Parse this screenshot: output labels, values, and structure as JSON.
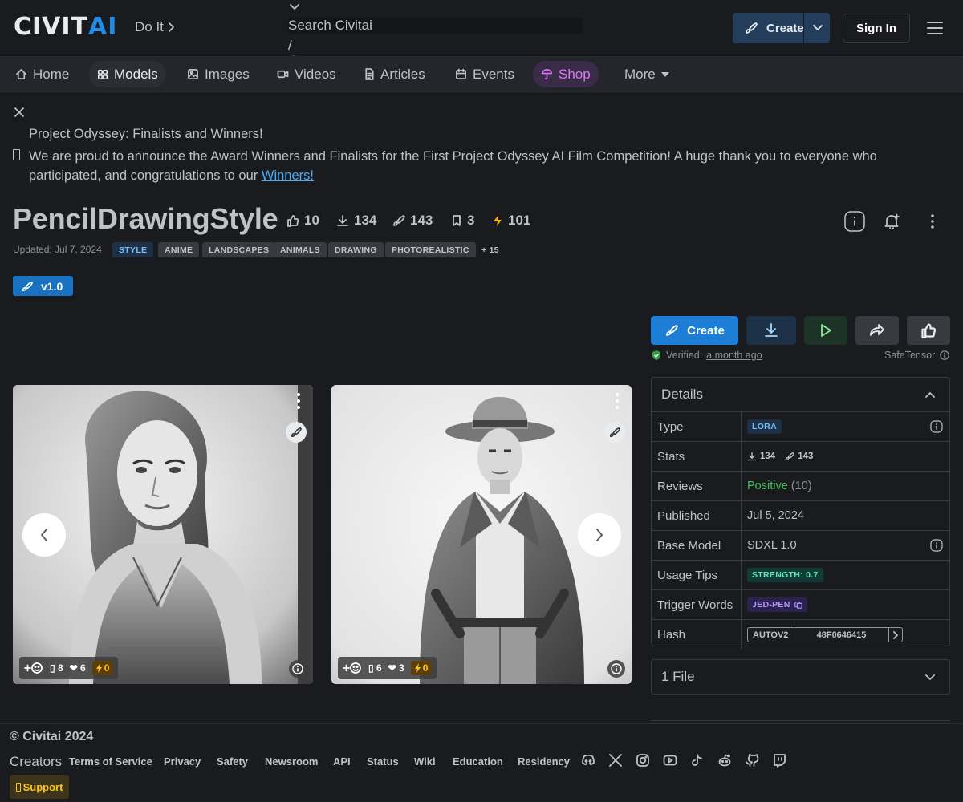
{
  "header": {
    "logo_text_a": "CIVIT",
    "logo_text_b": "AI",
    "doit": "Do It",
    "search_placeholder": "Search Civitai",
    "search_shortcut": "/",
    "create_label": "Create",
    "signin_label": "Sign In"
  },
  "nav": {
    "items": [
      {
        "label": "Home"
      },
      {
        "label": "Models"
      },
      {
        "label": "Images"
      },
      {
        "label": "Videos"
      },
      {
        "label": "Articles"
      },
      {
        "label": "Events"
      },
      {
        "label": "Shop"
      },
      {
        "label": "More"
      }
    ]
  },
  "announcement": {
    "title": "Project Odyssey: Finalists and Winners!",
    "body": "We are proud to announce the Award Winners and Finalists for the First Project Odyssey AI Film Competition! A huge thank you to everyone who participated, and congratulations to our",
    "link": "Winners!"
  },
  "model": {
    "title": "PencilDrawingStyle",
    "stats": {
      "likes": "10",
      "downloads": "134",
      "generations": "143",
      "bookmarks": "3",
      "buzz": "101"
    },
    "updated": "Updated: Jul 7, 2024",
    "tags": [
      "STYLE",
      "ANIME",
      "LANDSCAPES",
      "ANIMALS",
      "DRAWING",
      "PHOTOREALISTIC",
      "+ 15"
    ],
    "version": "v1.0"
  },
  "actions": {
    "create_label": "Create",
    "verified_label": "Verified:",
    "verified_time": "a month ago",
    "safetensor": "SafeTensor"
  },
  "gallery": [
    {
      "comments": "8",
      "likes": "6",
      "buzz": "0"
    },
    {
      "comments": "6",
      "likes": "3",
      "buzz": "0"
    }
  ],
  "details": {
    "heading": "Details",
    "type_label": "Type",
    "type_value": "LORA",
    "stats_label": "Stats",
    "stats_downloads": "134",
    "stats_generations": "143",
    "reviews_label": "Reviews",
    "reviews_value": "Positive",
    "reviews_count": "(10)",
    "published_label": "Published",
    "published_value": "Jul 5, 2024",
    "base_label": "Base Model",
    "base_value": "SDXL 1.0",
    "tips_label": "Usage Tips",
    "tips_value": "STRENGTH: 0.7",
    "trigger_label": "Trigger Words",
    "trigger_value": "JED-PEN",
    "hash_label": "Hash",
    "hash_type": "AUTOV2",
    "hash_value": "48F0646415"
  },
  "files": {
    "label": "1 File"
  },
  "footer": {
    "copyright": "© Civitai 2024",
    "creators": "Creators",
    "links": [
      "Terms of Service",
      "Privacy",
      "Safety",
      "Newsroom",
      "API",
      "Status",
      "Wiki",
      "Education",
      "Residency"
    ],
    "support": "Support"
  },
  "colors": {
    "accent_blue": "#1c7ed6",
    "shop_purple": "#da77f2",
    "positive_green": "#40c057",
    "buzz_yellow": "#fcc419"
  },
  "icons": [
    "home-icon",
    "grid-icon",
    "image-icon",
    "video-icon",
    "article-icon",
    "calendar-icon",
    "shop-icon",
    "thumb-up-icon",
    "download-icon",
    "brush-icon",
    "bookmark-icon",
    "bolt-icon",
    "info-icon",
    "bell-plus-icon",
    "dots-vertical-icon",
    "play-icon",
    "share-icon",
    "discord-icon",
    "x-icon",
    "instagram-icon",
    "youtube-icon",
    "tiktok-icon",
    "reddit-icon",
    "github-icon",
    "twitch-icon"
  ]
}
